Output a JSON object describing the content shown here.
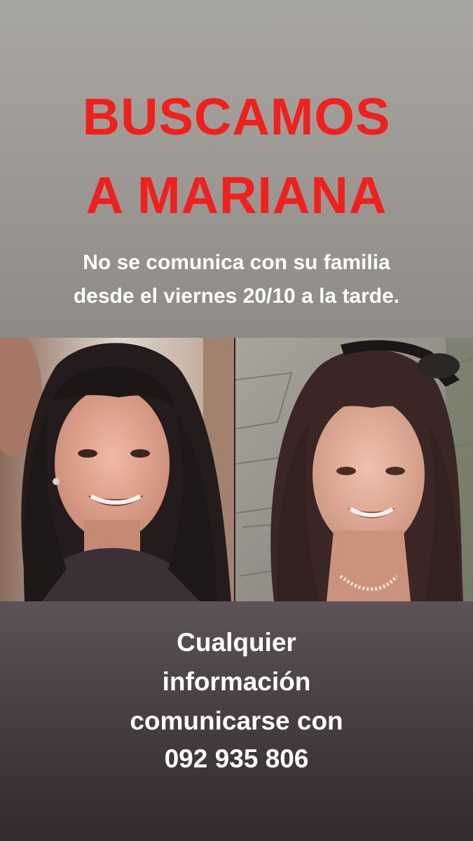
{
  "headline": {
    "line1": "BUSCAMOS",
    "line2": "A MARIANA"
  },
  "subtitle": {
    "line1": "No se comunica con su familia",
    "line2": "desde el viernes 20/10 a la tarde."
  },
  "contact": {
    "line1": "Cualquier",
    "line2": "información",
    "line3": "comunicarse con",
    "line4": "092 935 806"
  },
  "colors": {
    "headline": "#f0201c",
    "text": "#ffffff",
    "top_background": "#a3a09b",
    "bottom_background": "#463d42"
  }
}
